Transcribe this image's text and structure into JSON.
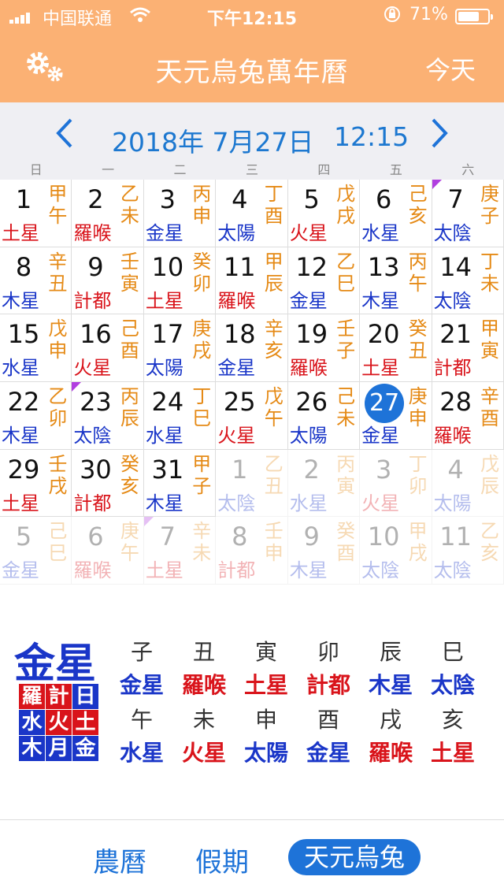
{
  "status_bar": {
    "carrier": "中国联通",
    "time": "下午12:15",
    "battery_pct": "71%",
    "battery_level": 0.71
  },
  "nav": {
    "title": "天元烏兔萬年曆",
    "today_label": "今天",
    "icon_settings": "gear-icon"
  },
  "date_header": {
    "date": "2018年 7月27日",
    "time": "12:15",
    "weekdays": [
      "日",
      "一",
      "二",
      "三",
      "四",
      "五",
      "六"
    ]
  },
  "calendar": {
    "days": [
      {
        "n": "1",
        "gz": "甲午",
        "star": "土星",
        "c": "#d9141b",
        "dim": false,
        "mark": false,
        "today": false
      },
      {
        "n": "2",
        "gz": "乙未",
        "star": "羅喉",
        "c": "#d9141b",
        "dim": false,
        "mark": false,
        "today": false
      },
      {
        "n": "3",
        "gz": "丙申",
        "star": "金星",
        "c": "#1a36c8",
        "dim": false,
        "mark": false,
        "today": false
      },
      {
        "n": "4",
        "gz": "丁酉",
        "star": "太陽",
        "c": "#1a36c8",
        "dim": false,
        "mark": false,
        "today": false
      },
      {
        "n": "5",
        "gz": "戊戌",
        "star": "火星",
        "c": "#d9141b",
        "dim": false,
        "mark": false,
        "today": false
      },
      {
        "n": "6",
        "gz": "己亥",
        "star": "水星",
        "c": "#1a36c8",
        "dim": false,
        "mark": false,
        "today": false
      },
      {
        "n": "7",
        "gz": "庚子",
        "star": "太陰",
        "c": "#1a36c8",
        "dim": false,
        "mark": true,
        "today": false
      },
      {
        "n": "8",
        "gz": "辛丑",
        "star": "木星",
        "c": "#1a36c8",
        "dim": false,
        "mark": false,
        "today": false
      },
      {
        "n": "9",
        "gz": "壬寅",
        "star": "計都",
        "c": "#d9141b",
        "dim": false,
        "mark": false,
        "today": false
      },
      {
        "n": "10",
        "gz": "癸卯",
        "star": "土星",
        "c": "#d9141b",
        "dim": false,
        "mark": false,
        "today": false
      },
      {
        "n": "11",
        "gz": "甲辰",
        "star": "羅喉",
        "c": "#d9141b",
        "dim": false,
        "mark": false,
        "today": false
      },
      {
        "n": "12",
        "gz": "乙巳",
        "star": "金星",
        "c": "#1a36c8",
        "dim": false,
        "mark": false,
        "today": false
      },
      {
        "n": "13",
        "gz": "丙午",
        "star": "木星",
        "c": "#1a36c8",
        "dim": false,
        "mark": false,
        "today": false
      },
      {
        "n": "14",
        "gz": "丁未",
        "star": "太陰",
        "c": "#1a36c8",
        "dim": false,
        "mark": false,
        "today": false
      },
      {
        "n": "15",
        "gz": "戊申",
        "star": "水星",
        "c": "#1a36c8",
        "dim": false,
        "mark": false,
        "today": false
      },
      {
        "n": "16",
        "gz": "己酉",
        "star": "火星",
        "c": "#d9141b",
        "dim": false,
        "mark": false,
        "today": false
      },
      {
        "n": "17",
        "gz": "庚戌",
        "star": "太陽",
        "c": "#1a36c8",
        "dim": false,
        "mark": false,
        "today": false
      },
      {
        "n": "18",
        "gz": "辛亥",
        "star": "金星",
        "c": "#1a36c8",
        "dim": false,
        "mark": false,
        "today": false
      },
      {
        "n": "19",
        "gz": "壬子",
        "star": "羅喉",
        "c": "#d9141b",
        "dim": false,
        "mark": false,
        "today": false
      },
      {
        "n": "20",
        "gz": "癸丑",
        "star": "土星",
        "c": "#d9141b",
        "dim": false,
        "mark": false,
        "today": false
      },
      {
        "n": "21",
        "gz": "甲寅",
        "star": "計都",
        "c": "#d9141b",
        "dim": false,
        "mark": false,
        "today": false
      },
      {
        "n": "22",
        "gz": "乙卯",
        "star": "木星",
        "c": "#1a36c8",
        "dim": false,
        "mark": false,
        "today": false
      },
      {
        "n": "23",
        "gz": "丙辰",
        "star": "太陰",
        "c": "#1a36c8",
        "dim": false,
        "mark": true,
        "today": false
      },
      {
        "n": "24",
        "gz": "丁巳",
        "star": "水星",
        "c": "#1a36c8",
        "dim": false,
        "mark": false,
        "today": false
      },
      {
        "n": "25",
        "gz": "戊午",
        "star": "火星",
        "c": "#d9141b",
        "dim": false,
        "mark": false,
        "today": false
      },
      {
        "n": "26",
        "gz": "己未",
        "star": "太陽",
        "c": "#1a36c8",
        "dim": false,
        "mark": false,
        "today": false
      },
      {
        "n": "27",
        "gz": "庚申",
        "star": "金星",
        "c": "#1a36c8",
        "dim": false,
        "mark": false,
        "today": true
      },
      {
        "n": "28",
        "gz": "辛酉",
        "star": "羅喉",
        "c": "#d9141b",
        "dim": false,
        "mark": false,
        "today": false
      },
      {
        "n": "29",
        "gz": "壬戌",
        "star": "土星",
        "c": "#d9141b",
        "dim": false,
        "mark": false,
        "today": false
      },
      {
        "n": "30",
        "gz": "癸亥",
        "star": "計都",
        "c": "#d9141b",
        "dim": false,
        "mark": false,
        "today": false
      },
      {
        "n": "31",
        "gz": "甲子",
        "star": "木星",
        "c": "#1a36c8",
        "dim": false,
        "mark": false,
        "today": false
      },
      {
        "n": "1",
        "gz": "乙丑",
        "star": "太陰",
        "c": "#1a36c8",
        "dim": true,
        "mark": false,
        "today": false
      },
      {
        "n": "2",
        "gz": "丙寅",
        "star": "水星",
        "c": "#1a36c8",
        "dim": true,
        "mark": false,
        "today": false
      },
      {
        "n": "3",
        "gz": "丁卯",
        "star": "火星",
        "c": "#d9141b",
        "dim": true,
        "mark": false,
        "today": false
      },
      {
        "n": "4",
        "gz": "戊辰",
        "star": "太陽",
        "c": "#1a36c8",
        "dim": true,
        "mark": false,
        "today": false
      },
      {
        "n": "5",
        "gz": "己巳",
        "star": "金星",
        "c": "#1a36c8",
        "dim": true,
        "mark": false,
        "today": false
      },
      {
        "n": "6",
        "gz": "庚午",
        "star": "羅喉",
        "c": "#d9141b",
        "dim": true,
        "mark": false,
        "today": false
      },
      {
        "n": "7",
        "gz": "辛未",
        "star": "土星",
        "c": "#d9141b",
        "dim": true,
        "mark": true,
        "today": false
      },
      {
        "n": "8",
        "gz": "壬申",
        "star": "計都",
        "c": "#d9141b",
        "dim": true,
        "mark": false,
        "today": false
      },
      {
        "n": "9",
        "gz": "癸酉",
        "star": "木星",
        "c": "#1a36c8",
        "dim": true,
        "mark": false,
        "today": false
      },
      {
        "n": "10",
        "gz": "甲戌",
        "star": "太陰",
        "c": "#1a36c8",
        "dim": true,
        "mark": false,
        "today": false
      },
      {
        "n": "11",
        "gz": "乙亥",
        "star": "太陰",
        "c": "#1a36c8",
        "dim": true,
        "mark": false,
        "today": false
      }
    ]
  },
  "detail": {
    "big_star": "金星",
    "star_box": [
      {
        "t": "羅",
        "bg": "#d9141b"
      },
      {
        "t": "計",
        "bg": "#d9141b"
      },
      {
        "t": "日",
        "bg": "#1a36c8"
      },
      {
        "t": "水",
        "bg": "#1a36c8"
      },
      {
        "t": "火",
        "bg": "#d9141b"
      },
      {
        "t": "土",
        "bg": "#d9141b"
      },
      {
        "t": "木",
        "bg": "#1a36c8"
      },
      {
        "t": "月",
        "bg": "#1a36c8"
      },
      {
        "t": "金",
        "bg": "#1a36c8"
      }
    ],
    "hours": [
      {
        "b": "子",
        "s": "金星",
        "c": "#1a36c8"
      },
      {
        "b": "丑",
        "s": "羅喉",
        "c": "#d9141b"
      },
      {
        "b": "寅",
        "s": "土星",
        "c": "#d9141b"
      },
      {
        "b": "卯",
        "s": "計都",
        "c": "#d9141b"
      },
      {
        "b": "辰",
        "s": "木星",
        "c": "#1a36c8"
      },
      {
        "b": "巳",
        "s": "太陰",
        "c": "#1a36c8"
      },
      {
        "b": "午",
        "s": "水星",
        "c": "#1a36c8"
      },
      {
        "b": "未",
        "s": "火星",
        "c": "#d9141b"
      },
      {
        "b": "申",
        "s": "太陽",
        "c": "#1a36c8"
      },
      {
        "b": "酉",
        "s": "金星",
        "c": "#1a36c8"
      },
      {
        "b": "戌",
        "s": "羅喉",
        "c": "#d9141b"
      },
      {
        "b": "亥",
        "s": "土星",
        "c": "#d9141b"
      }
    ]
  },
  "tabs": {
    "lunar": "農曆",
    "holiday": "假期",
    "active": "天元烏兔"
  },
  "colors": {
    "header_bg": "#fbb174",
    "accent": "#1e73d8",
    "ganzhi": "#e58a16",
    "red_star": "#d9141b",
    "blue_star": "#1a36c8"
  }
}
